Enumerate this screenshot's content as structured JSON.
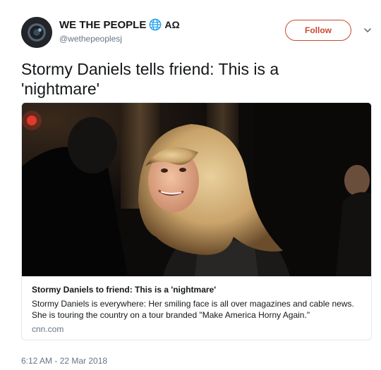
{
  "author": {
    "display_name": "WE THE PEOPLE",
    "name_symbols": "ΑΩ",
    "handle": "@wethepeoplesj"
  },
  "follow_label": "Follow",
  "tweet_text": "Stormy Daniels tells friend: This is a 'nightmare'",
  "card": {
    "title": "Stormy Daniels to friend: This is a 'nightmare'",
    "description": "Stormy Daniels is everywhere: Her smiling face is all over magazines and cable news. She is touring the country on a tour branded \"Make America Horny Again.\"",
    "domain": "cnn.com"
  },
  "timestamp": "6:12 AM - 22 Mar 2018",
  "colors": {
    "follow_accent": "#c8492f",
    "secondary_text": "#657786",
    "globe": "#1da1f2"
  },
  "icons": {
    "globe": "globe-icon",
    "caret": "chevron-down-icon"
  }
}
